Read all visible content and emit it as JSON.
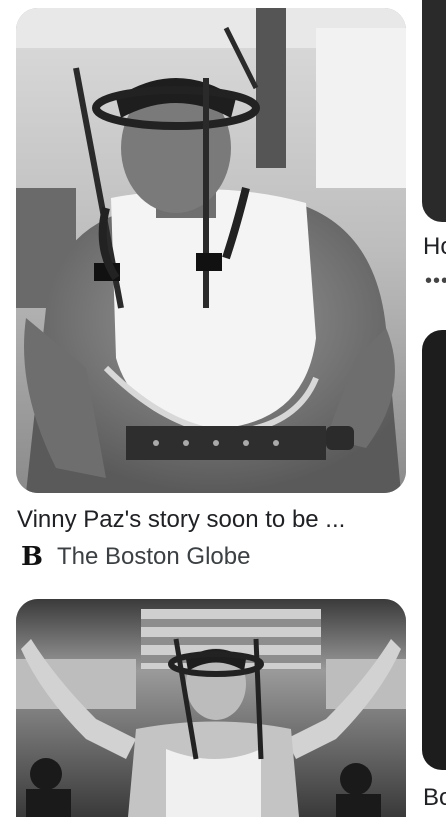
{
  "results": [
    {
      "title": "Vinny Paz's story soon to be ...",
      "source": {
        "name": "The Boston Globe",
        "logo_glyph": "B"
      },
      "image": {
        "icon": "photo-man-in-halo-brace",
        "tone": "grayscale"
      }
    },
    {
      "image": {
        "icon": "photo-man-arms-raised-halo",
        "tone": "grayscale"
      }
    }
  ],
  "side_column": {
    "title_top": "Ho",
    "dots": "•••",
    "title_bottom": "Bo"
  }
}
